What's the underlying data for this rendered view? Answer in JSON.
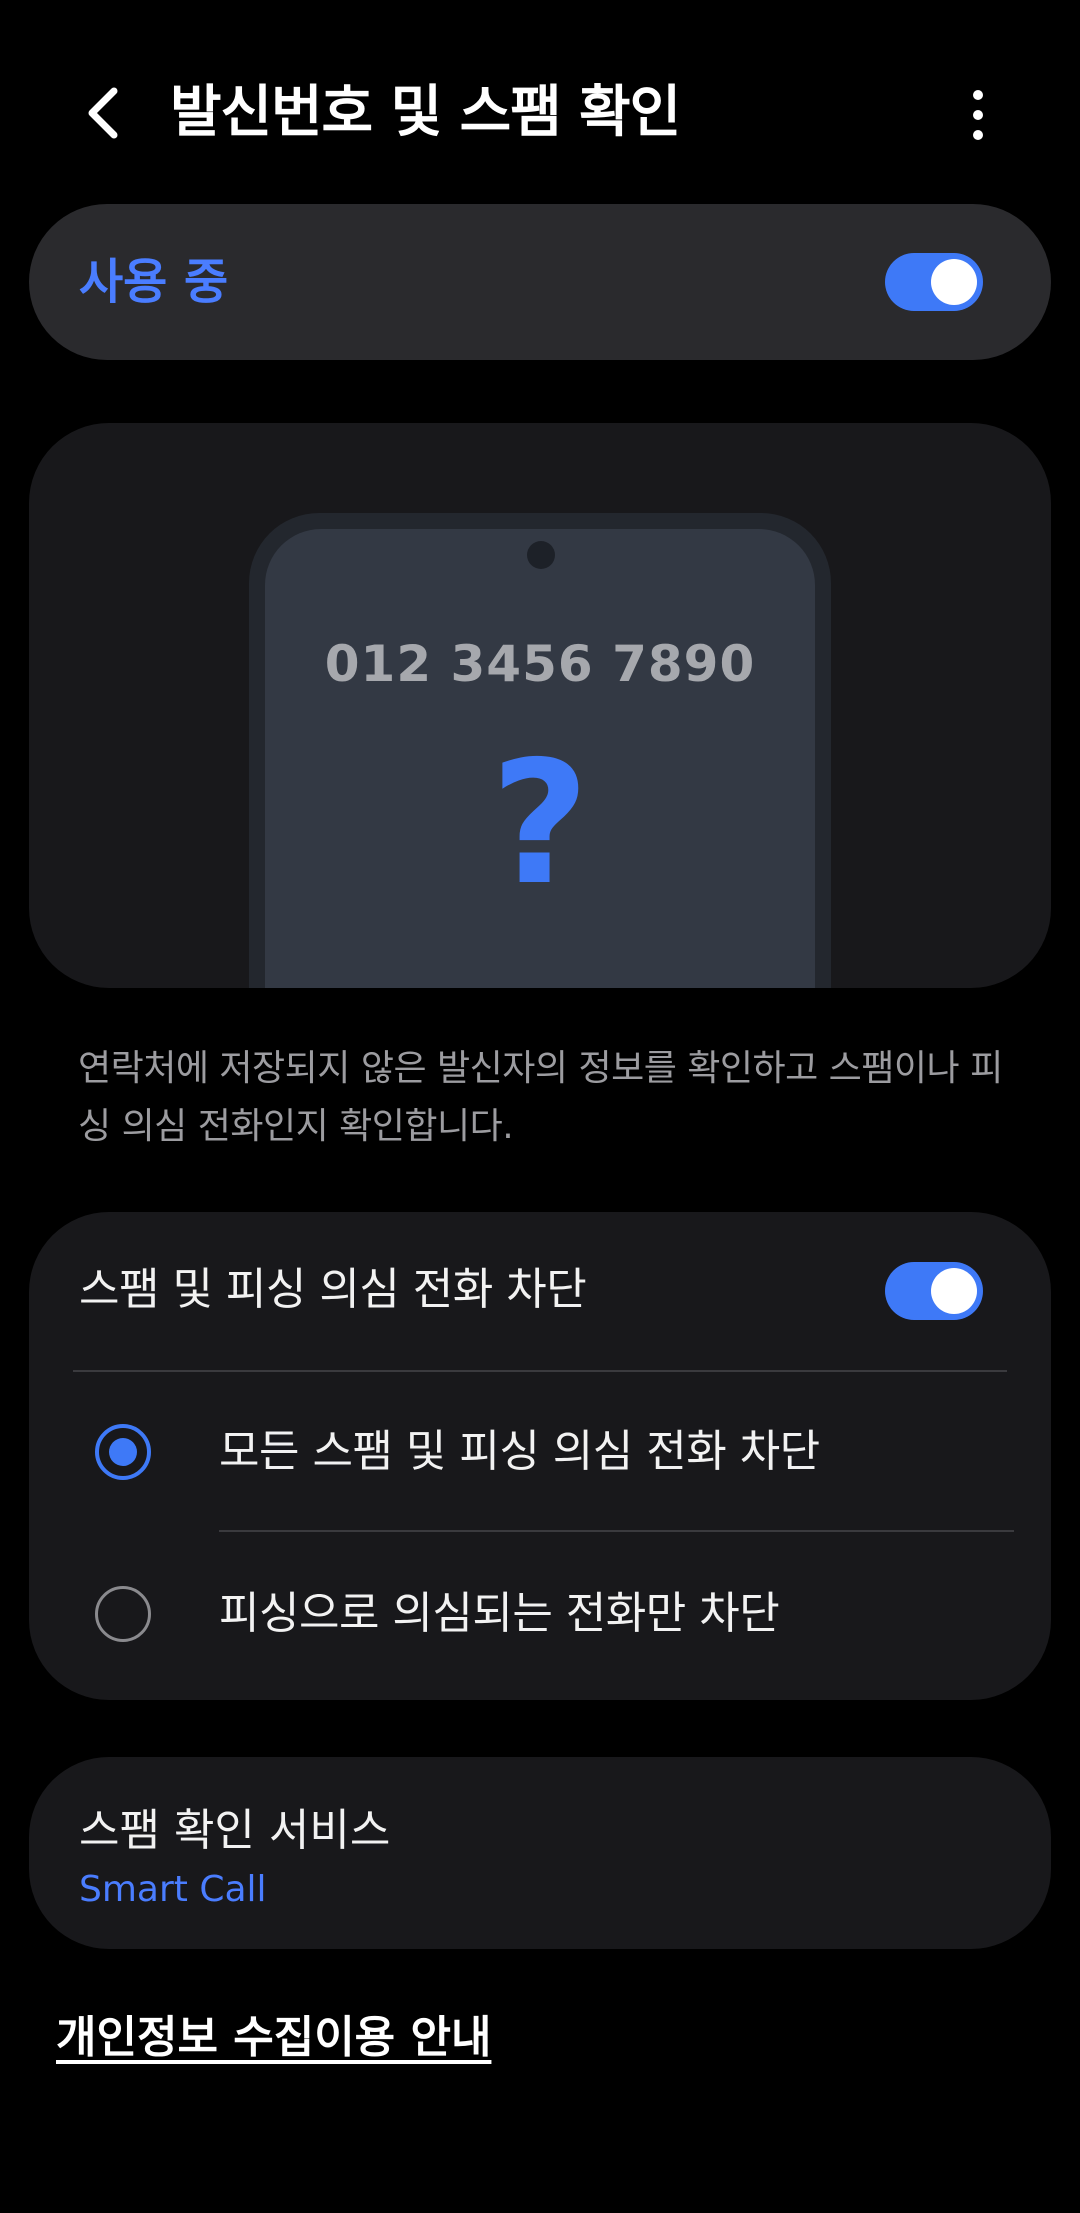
{
  "header": {
    "title": "발신번호 및 스팸 확인",
    "back_icon": "chevron-left-icon",
    "more_icon": "more-vertical-icon"
  },
  "master_switch": {
    "label": "사용 중",
    "state": "on"
  },
  "illustration": {
    "phone_number": "012 3456 7890",
    "symbol": "?"
  },
  "description": "연락처에 저장되지 않은 발신자의 정보를 확인하고 스팸이나 피싱 의심 전화인지 확인합니다.",
  "block_section": {
    "title": "스팸 및 피싱 의심 전화 차단",
    "toggle_state": "on",
    "options": [
      {
        "label": "모든 스팸 및 피싱 의심 전화 차단",
        "selected": true
      },
      {
        "label": "피싱으로 의심되는 전화만 차단",
        "selected": false
      }
    ]
  },
  "service": {
    "title": "스팸 확인 서비스",
    "provider": "Smart Call"
  },
  "privacy_link": "개인정보 수집이용 안내",
  "colors": {
    "accent": "#3e79f7",
    "label_accent": "#4a7dff",
    "background": "#000000",
    "card": "#18181b"
  }
}
